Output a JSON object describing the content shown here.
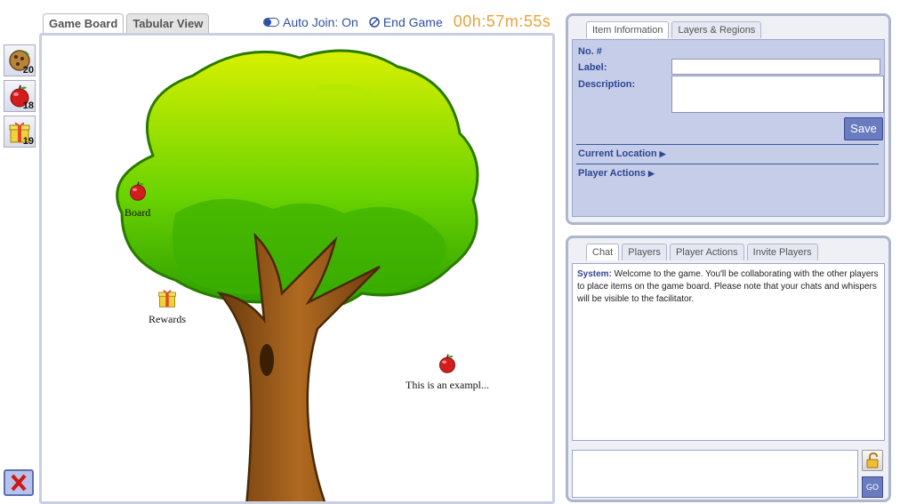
{
  "palette": [
    {
      "icon": "cookie-icon",
      "count": "20"
    },
    {
      "icon": "apple-icon",
      "count": "18"
    },
    {
      "icon": "gift-icon",
      "count": "19"
    }
  ],
  "tabs": {
    "game_board": "Game Board",
    "tabular_view": "Tabular View"
  },
  "topbar": {
    "auto_join": "Auto Join: On",
    "end_game": "End Game",
    "timer": "00h:57m:55s"
  },
  "board": {
    "markers": [
      {
        "icon": "apple-icon",
        "label": "Board"
      },
      {
        "icon": "gift-icon",
        "label": "Rewards"
      },
      {
        "icon": "apple-icon",
        "label": "This is an exampl..."
      }
    ]
  },
  "info_panel": {
    "tabs": [
      "Item Information",
      "Layers & Regions"
    ],
    "no_label": "No. #",
    "label_label": "Label:",
    "label_value": "",
    "description_label": "Description:",
    "description_value": "",
    "save": "Save",
    "current_location": "Current Location",
    "player_actions": "Player Actions"
  },
  "chat_panel": {
    "tabs": [
      "Chat",
      "Players",
      "Player Actions",
      "Invite Players"
    ],
    "messages": [
      {
        "sender": "System:",
        "text": " Welcome to the game. You'll be collaborating with the other players to place items on the game board. Please note that your chats and whispers will be visible to the facilitator."
      }
    ],
    "input_value": "",
    "go": "GO"
  }
}
